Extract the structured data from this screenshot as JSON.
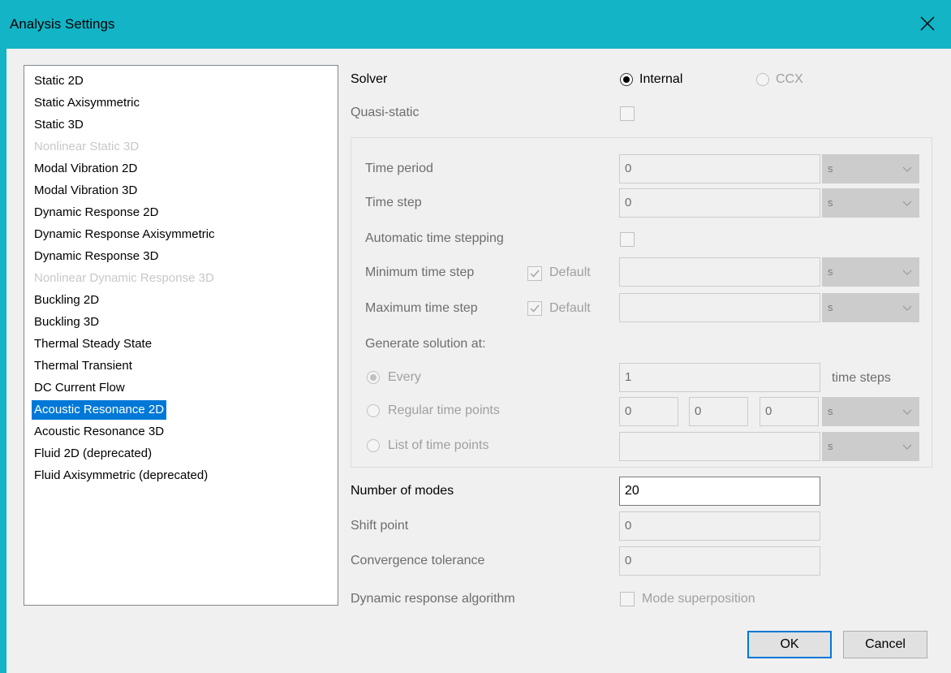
{
  "window": {
    "title": "Analysis Settings",
    "close_icon": "close-icon"
  },
  "analysis_types": [
    {
      "label": "Static 2D",
      "state": "normal"
    },
    {
      "label": "Static Axisymmetric",
      "state": "normal"
    },
    {
      "label": "Static 3D",
      "state": "normal"
    },
    {
      "label": "Nonlinear Static 3D",
      "state": "disabled"
    },
    {
      "label": "Modal Vibration 2D",
      "state": "normal"
    },
    {
      "label": "Modal Vibration 3D",
      "state": "normal"
    },
    {
      "label": "Dynamic Response 2D",
      "state": "normal"
    },
    {
      "label": "Dynamic Response Axisymmetric",
      "state": "normal"
    },
    {
      "label": "Dynamic Response 3D",
      "state": "normal"
    },
    {
      "label": "Nonlinear Dynamic Response 3D",
      "state": "disabled"
    },
    {
      "label": "Buckling 2D",
      "state": "normal"
    },
    {
      "label": "Buckling 3D",
      "state": "normal"
    },
    {
      "label": "Thermal Steady State",
      "state": "normal"
    },
    {
      "label": "Thermal Transient",
      "state": "normal"
    },
    {
      "label": "DC Current Flow",
      "state": "normal"
    },
    {
      "label": "Acoustic Resonance 2D",
      "state": "selected"
    },
    {
      "label": "Acoustic Resonance 3D",
      "state": "normal"
    },
    {
      "label": "Fluid 2D (deprecated)",
      "state": "normal"
    },
    {
      "label": "Fluid Axisymmetric (deprecated)",
      "state": "normal"
    }
  ],
  "solver": {
    "label": "Solver",
    "options": [
      {
        "label": "Internal",
        "checked": true,
        "enabled": true
      },
      {
        "label": "CCX",
        "checked": false,
        "enabled": false
      }
    ]
  },
  "quasi_static": {
    "label": "Quasi-static",
    "checked": false
  },
  "time": {
    "time_period": {
      "label": "Time period",
      "value": "0",
      "unit": "s"
    },
    "time_step": {
      "label": "Time step",
      "value": "0",
      "unit": "s"
    },
    "automatic_stepping": {
      "label": "Automatic time stepping",
      "checked": false
    },
    "min_step": {
      "label": "Minimum time step",
      "default_label": "Default",
      "default_checked": true,
      "value": "",
      "unit": "s"
    },
    "max_step": {
      "label": "Maximum time step",
      "default_label": "Default",
      "default_checked": true,
      "value": "",
      "unit": "s"
    },
    "generate_label": "Generate solution at:",
    "every": {
      "label": "Every",
      "value": "1",
      "suffix": "time steps",
      "checked": true
    },
    "regular": {
      "label": "Regular time points",
      "v1": "0",
      "v2": "0",
      "v3": "0",
      "unit": "s",
      "checked": false
    },
    "list": {
      "label": "List of time points",
      "value": "",
      "unit": "s",
      "checked": false
    }
  },
  "modes": {
    "number_of_modes": {
      "label": "Number of modes",
      "value": "20"
    },
    "shift_point": {
      "label": "Shift point",
      "value": "0"
    },
    "convergence": {
      "label": "Convergence tolerance",
      "value": "0"
    },
    "algorithm": {
      "label": "Dynamic response algorithm",
      "option_label": "Mode superposition",
      "checked": false
    }
  },
  "buttons": {
    "ok": "OK",
    "cancel": "Cancel"
  },
  "colors": {
    "titlebar": "#12b4c6",
    "selection": "#0078d7",
    "dialog_bg": "#f0f0f0"
  }
}
